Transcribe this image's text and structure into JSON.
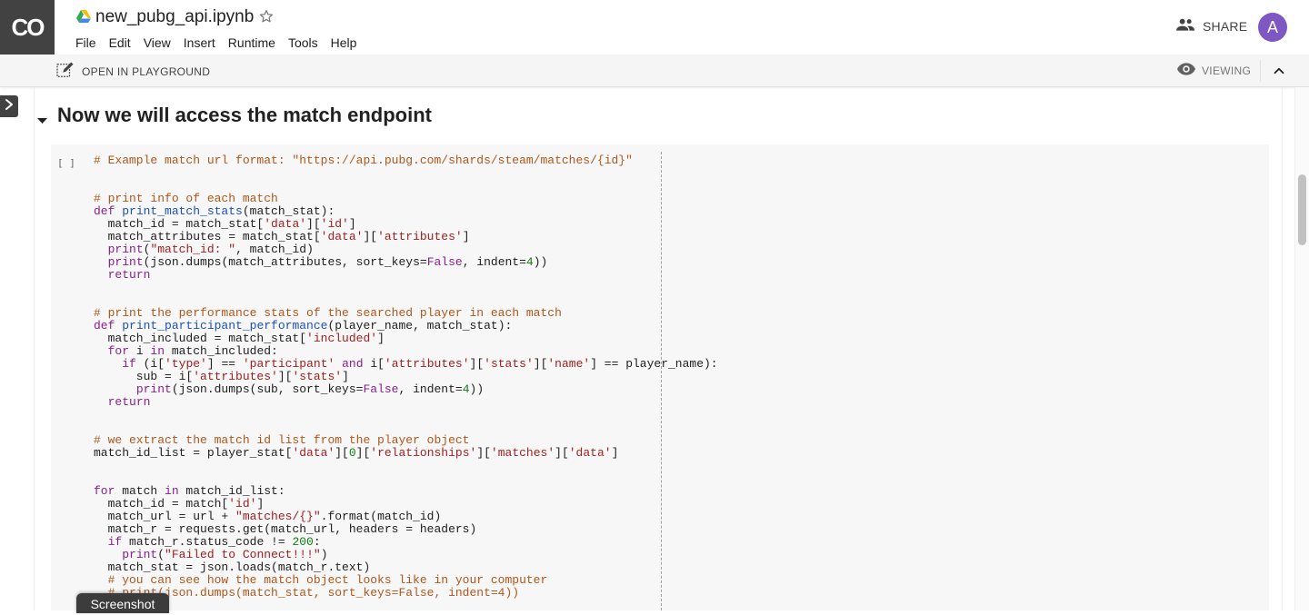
{
  "app": {
    "logo_text": "CO",
    "notebook_title": "new_pubg_api.ipynb"
  },
  "menu": [
    "File",
    "Edit",
    "View",
    "Insert",
    "Runtime",
    "Tools",
    "Help"
  ],
  "header": {
    "share_label": "SHARE",
    "avatar_initial": "A"
  },
  "toolbar": {
    "playground_label": "OPEN IN PLAYGROUND",
    "viewing_label": "VIEWING"
  },
  "section": {
    "heading": "Now we will access the match endpoint"
  },
  "cell": {
    "run_indicator": "[ ]",
    "code_lines": [
      [
        {
          "t": "# Example match url format: \"https://api.pubg.com/shards/steam/matches/{id}\"",
          "c": "comment"
        }
      ],
      [],
      [],
      [
        {
          "t": "# print info of each match",
          "c": "comment"
        }
      ],
      [
        {
          "t": "def ",
          "c": "keyword"
        },
        {
          "t": "print_match_stats",
          "c": "def"
        },
        {
          "t": "(match_stat):",
          "c": "default"
        }
      ],
      [
        {
          "t": "  match_id = match_stat[",
          "c": "default"
        },
        {
          "t": "'data'",
          "c": "string"
        },
        {
          "t": "][",
          "c": "default"
        },
        {
          "t": "'id'",
          "c": "string"
        },
        {
          "t": "]",
          "c": "default"
        }
      ],
      [
        {
          "t": "  match_attributes = match_stat[",
          "c": "default"
        },
        {
          "t": "'data'",
          "c": "string"
        },
        {
          "t": "][",
          "c": "default"
        },
        {
          "t": "'attributes'",
          "c": "string"
        },
        {
          "t": "]",
          "c": "default"
        }
      ],
      [
        {
          "t": "  ",
          "c": "default"
        },
        {
          "t": "print",
          "c": "keyword"
        },
        {
          "t": "(",
          "c": "default"
        },
        {
          "t": "\"match_id: \"",
          "c": "string"
        },
        {
          "t": ", match_id)",
          "c": "default"
        }
      ],
      [
        {
          "t": "  ",
          "c": "default"
        },
        {
          "t": "print",
          "c": "keyword"
        },
        {
          "t": "(json.dumps(match_attributes, sort_keys=",
          "c": "default"
        },
        {
          "t": "False",
          "c": "keyword"
        },
        {
          "t": ", indent=",
          "c": "default"
        },
        {
          "t": "4",
          "c": "number"
        },
        {
          "t": "))",
          "c": "default"
        }
      ],
      [
        {
          "t": "  ",
          "c": "default"
        },
        {
          "t": "return",
          "c": "keyword"
        }
      ],
      [],
      [],
      [
        {
          "t": "# print the performance stats of the searched player in each match",
          "c": "comment"
        }
      ],
      [
        {
          "t": "def ",
          "c": "keyword"
        },
        {
          "t": "print_participant_performance",
          "c": "def"
        },
        {
          "t": "(player_name, match_stat):",
          "c": "default"
        }
      ],
      [
        {
          "t": "  match_included = match_stat[",
          "c": "default"
        },
        {
          "t": "'included'",
          "c": "string"
        },
        {
          "t": "]",
          "c": "default"
        }
      ],
      [
        {
          "t": "  ",
          "c": "default"
        },
        {
          "t": "for",
          "c": "keyword"
        },
        {
          "t": " i ",
          "c": "default"
        },
        {
          "t": "in",
          "c": "keyword"
        },
        {
          "t": " match_included:",
          "c": "default"
        }
      ],
      [
        {
          "t": "    ",
          "c": "default"
        },
        {
          "t": "if",
          "c": "keyword"
        },
        {
          "t": " (i[",
          "c": "default"
        },
        {
          "t": "'type'",
          "c": "string"
        },
        {
          "t": "] == ",
          "c": "default"
        },
        {
          "t": "'participant'",
          "c": "string"
        },
        {
          "t": " ",
          "c": "default"
        },
        {
          "t": "and",
          "c": "keyword"
        },
        {
          "t": " i[",
          "c": "default"
        },
        {
          "t": "'attributes'",
          "c": "string"
        },
        {
          "t": "][",
          "c": "default"
        },
        {
          "t": "'stats'",
          "c": "string"
        },
        {
          "t": "][",
          "c": "default"
        },
        {
          "t": "'name'",
          "c": "string"
        },
        {
          "t": "] == player_name):",
          "c": "default"
        }
      ],
      [
        {
          "t": "      sub = i[",
          "c": "default"
        },
        {
          "t": "'attributes'",
          "c": "string"
        },
        {
          "t": "][",
          "c": "default"
        },
        {
          "t": "'stats'",
          "c": "string"
        },
        {
          "t": "]",
          "c": "default"
        }
      ],
      [
        {
          "t": "      ",
          "c": "default"
        },
        {
          "t": "print",
          "c": "keyword"
        },
        {
          "t": "(json.dumps(sub, sort_keys=",
          "c": "default"
        },
        {
          "t": "False",
          "c": "keyword"
        },
        {
          "t": ", indent=",
          "c": "default"
        },
        {
          "t": "4",
          "c": "number"
        },
        {
          "t": "))",
          "c": "default"
        }
      ],
      [
        {
          "t": "  ",
          "c": "default"
        },
        {
          "t": "return",
          "c": "keyword"
        }
      ],
      [],
      [],
      [
        {
          "t": "# we extract the match id list from the player object",
          "c": "comment"
        }
      ],
      [
        {
          "t": "match_id_list = player_stat[",
          "c": "default"
        },
        {
          "t": "'data'",
          "c": "string"
        },
        {
          "t": "][",
          "c": "default"
        },
        {
          "t": "0",
          "c": "number"
        },
        {
          "t": "][",
          "c": "default"
        },
        {
          "t": "'relationships'",
          "c": "string"
        },
        {
          "t": "][",
          "c": "default"
        },
        {
          "t": "'matches'",
          "c": "string"
        },
        {
          "t": "][",
          "c": "default"
        },
        {
          "t": "'data'",
          "c": "string"
        },
        {
          "t": "]",
          "c": "default"
        }
      ],
      [],
      [],
      [
        {
          "t": "for",
          "c": "keyword"
        },
        {
          "t": " match ",
          "c": "default"
        },
        {
          "t": "in",
          "c": "keyword"
        },
        {
          "t": " match_id_list:",
          "c": "default"
        }
      ],
      [
        {
          "t": "  match_id = match[",
          "c": "default"
        },
        {
          "t": "'id'",
          "c": "string"
        },
        {
          "t": "]",
          "c": "default"
        }
      ],
      [
        {
          "t": "  match_url = url + ",
          "c": "default"
        },
        {
          "t": "\"matches/{}\"",
          "c": "string"
        },
        {
          "t": ".format(match_id)",
          "c": "default"
        }
      ],
      [
        {
          "t": "  match_r = requests.get(match_url, headers = headers)",
          "c": "default"
        }
      ],
      [
        {
          "t": "  ",
          "c": "default"
        },
        {
          "t": "if",
          "c": "keyword"
        },
        {
          "t": " match_r.status_code != ",
          "c": "default"
        },
        {
          "t": "200",
          "c": "number"
        },
        {
          "t": ":",
          "c": "default"
        }
      ],
      [
        {
          "t": "    ",
          "c": "default"
        },
        {
          "t": "print",
          "c": "keyword"
        },
        {
          "t": "(",
          "c": "default"
        },
        {
          "t": "\"Failed to Connect!!!\"",
          "c": "string"
        },
        {
          "t": ")",
          "c": "default"
        }
      ],
      [
        {
          "t": "  match_stat = json.loads(match_r.text)",
          "c": "default"
        }
      ],
      [
        {
          "t": "  # you can see how the match object looks like in your computer",
          "c": "comment"
        }
      ],
      [
        {
          "t": "  # print(json.dumps(match_stat, sort_keys=False, indent=4))",
          "c": "comment"
        }
      ]
    ]
  },
  "overlay": {
    "screenshot_label": "Screenshot"
  },
  "icons": {
    "drive": "google-drive-icon",
    "star": "star-outline-icon",
    "share": "people-icon",
    "playground": "edit-note-icon",
    "viewing": "eye-icon",
    "collapse": "chevron-up-icon",
    "side_toggle": "chevron-right-icon",
    "section_toggle": "caret-down-icon"
  },
  "colors": {
    "logo_bg": "#424242",
    "avatar_bg": "#7e57c2",
    "comment": "#b0561a",
    "keyword": "#8a1e8f",
    "string": "#a1201f",
    "number": "#0f7f12",
    "def_name": "#1b4fbf"
  }
}
